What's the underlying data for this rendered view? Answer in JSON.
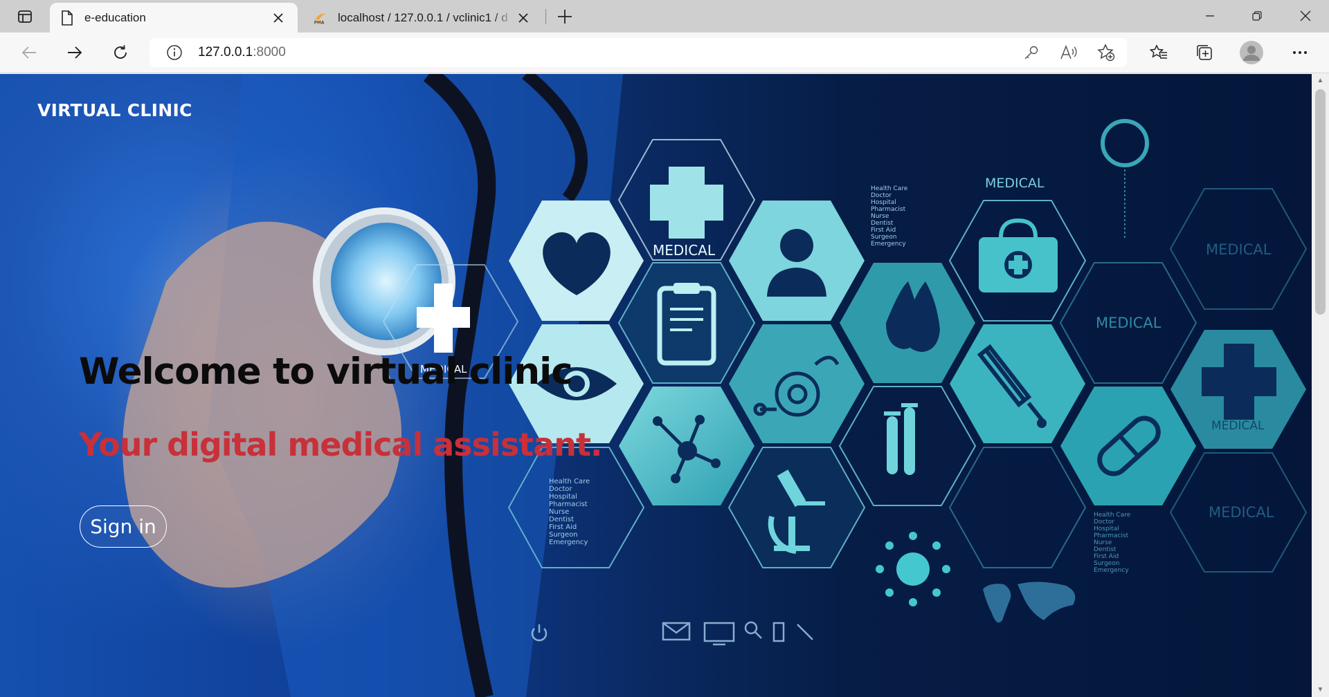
{
  "browser": {
    "tabs": [
      {
        "title": "e-education",
        "active": true
      },
      {
        "title": "localhost / 127.0.0.1 / vclinic1 / d",
        "favicon_text": "PMA",
        "active": false
      }
    ],
    "address": {
      "host": "127.0.0.1",
      "port": ":8000"
    }
  },
  "page": {
    "brand": "VIRTUAL CLINIC",
    "hero_title": "Welcome to virtual clinic",
    "hero_subtitle": "Your digital medical assistant.",
    "signin_label": "Sign in"
  },
  "background_art": {
    "medical_labels": [
      "MEDICAL",
      "MEDICAL",
      "MEDICAL",
      "MEDICAL",
      "MEDICAL",
      "MEDICAL",
      "MEDICAL"
    ],
    "hex_list_text": [
      "Health Care",
      "Doctor",
      "Hospital",
      "Pharmacist",
      "Nurse",
      "Dentist",
      "First Aid",
      "Surgeon",
      "Emergency"
    ]
  },
  "colors": {
    "accent": "#c8303a",
    "hex_cyan": "#3fb6c4",
    "hex_light": "#bdeef2",
    "navy": "#04163a"
  }
}
